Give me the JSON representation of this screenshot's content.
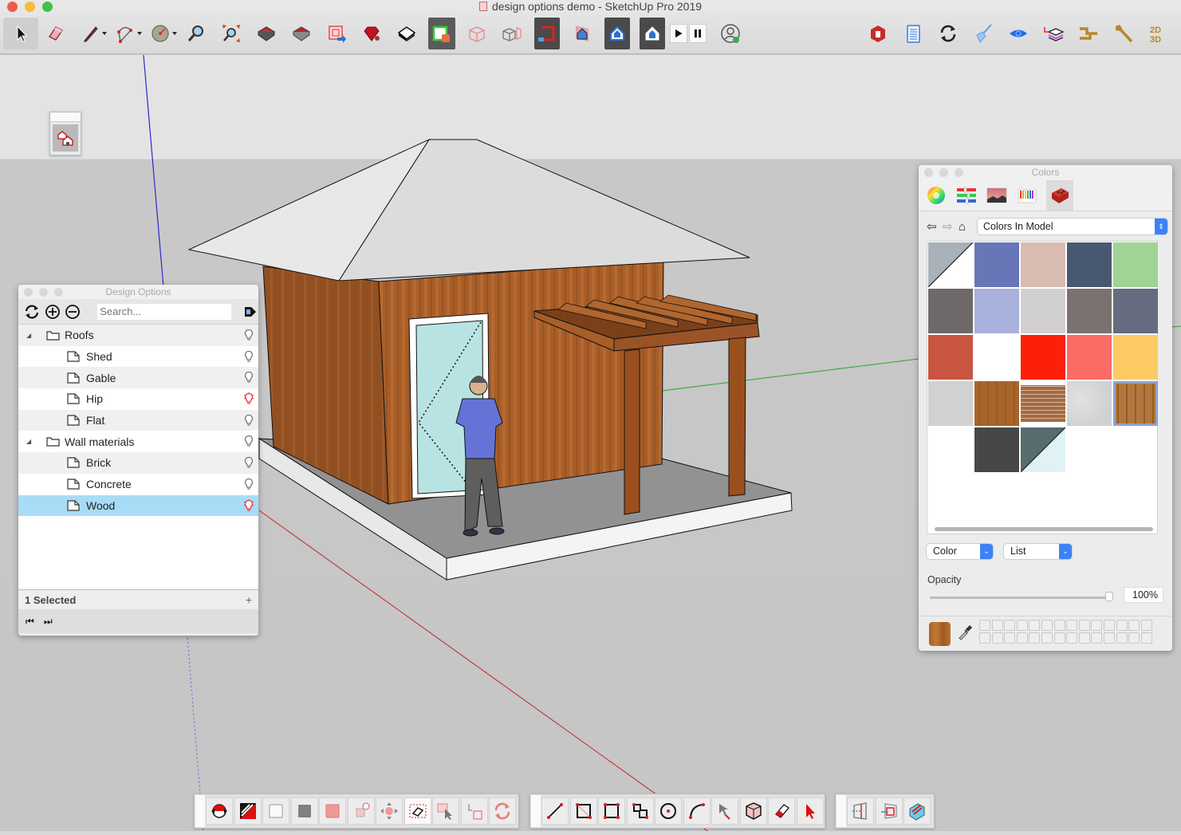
{
  "window": {
    "title": "design options demo - SketchUp Pro 2019"
  },
  "main_toolbar": {
    "left_tools": [
      {
        "name": "select-tool",
        "label": "Select",
        "active": true
      },
      {
        "name": "eraser-tool",
        "label": "Eraser"
      },
      {
        "name": "line-tool",
        "label": "Line",
        "dropdown": true
      },
      {
        "name": "arc-tool",
        "label": "Arc",
        "dropdown": true
      },
      {
        "name": "protractor-tool",
        "label": "Protractor",
        "dropdown": true
      },
      {
        "name": "zoom-tool",
        "label": "Zoom"
      },
      {
        "name": "zoom-extents-tool",
        "label": "Zoom Extents"
      },
      {
        "name": "warehouse-tool",
        "label": "3D Warehouse"
      },
      {
        "name": "share-model-tool",
        "label": "Share Model"
      },
      {
        "name": "send-to-layout-tool",
        "label": "Send to LayOut"
      },
      {
        "name": "extension-warehouse-tool",
        "label": "Extension Warehouse"
      },
      {
        "name": "paint-bucket-tool",
        "label": "Paint Bucket"
      },
      {
        "name": "component-tool",
        "label": "Make Component",
        "active": true
      },
      {
        "name": "section-cube-tool",
        "label": "Section"
      },
      {
        "name": "solid-tools",
        "label": "Solid Tools"
      },
      {
        "name": "magnet-tool",
        "label": "Magnet"
      },
      {
        "name": "house-view-tool",
        "label": "House View"
      },
      {
        "name": "house-view-tool-2",
        "label": "House View 2"
      },
      {
        "name": "house-view-tool-3",
        "label": "House View 3"
      },
      {
        "name": "play-button",
        "label": "Play"
      },
      {
        "name": "pause-button",
        "label": "Pause"
      },
      {
        "name": "account-button",
        "label": "Account"
      }
    ],
    "right_tools": [
      {
        "name": "extension-manager-tool",
        "label": "Extension Manager"
      },
      {
        "name": "notes-tool",
        "label": "Notes"
      },
      {
        "name": "refresh-tool",
        "label": "Refresh"
      },
      {
        "name": "cleanup-tool",
        "label": "Cleanup"
      },
      {
        "name": "visibility-tool",
        "label": "Visibility"
      },
      {
        "name": "layers-tool",
        "label": "Layers"
      },
      {
        "name": "pipes-tool",
        "label": "Pipes"
      },
      {
        "name": "wrench-tool",
        "label": "Wrench"
      },
      {
        "name": "2d3d-tool",
        "label": "2D/3D"
      }
    ]
  },
  "design_options": {
    "title": "Design Options",
    "search_placeholder": "Search...",
    "tree": [
      {
        "label": "Roofs",
        "type": "folder",
        "expanded": true,
        "active": false
      },
      {
        "label": "Shed",
        "type": "option",
        "active": false
      },
      {
        "label": "Gable",
        "type": "option",
        "active": false
      },
      {
        "label": "Hip",
        "type": "option",
        "active": true
      },
      {
        "label": "Flat",
        "type": "option",
        "active": false
      },
      {
        "label": "Wall materials",
        "type": "folder",
        "expanded": true,
        "active": false
      },
      {
        "label": "Brick",
        "type": "option",
        "active": false
      },
      {
        "label": "Concrete",
        "type": "option",
        "active": false
      },
      {
        "label": "Wood",
        "type": "option",
        "active": true,
        "selected": true
      }
    ],
    "status": "1 Selected",
    "status_plus": "+",
    "nav_prev": "⏮",
    "nav_next": "⏭"
  },
  "colors": {
    "title": "Colors",
    "tabs": [
      "color-wheel",
      "color-sliders",
      "color-image",
      "color-pencils",
      "materials"
    ],
    "active_tab": "materials",
    "collection": "Colors In Model",
    "swatches": [
      {
        "type": "split",
        "a": "#a9b1b8",
        "b": "#ffffff"
      },
      {
        "type": "solid",
        "color": "#6776b6"
      },
      {
        "type": "solid",
        "color": "#d8bcb0"
      },
      {
        "type": "solid",
        "color": "#495871"
      },
      {
        "type": "solid",
        "color": "#a0d495"
      },
      {
        "type": "solid",
        "color": "#6e6869"
      },
      {
        "type": "solid",
        "color": "#a8b0dc"
      },
      {
        "type": "solid",
        "color": "#d1cfd0"
      },
      {
        "type": "solid",
        "color": "#7b716f"
      },
      {
        "type": "solid",
        "color": "#676b7f"
      },
      {
        "type": "solid",
        "color": "#c85641"
      },
      {
        "type": "solid",
        "color": "#ffffff"
      },
      {
        "type": "solid",
        "color": "#fb2007"
      },
      {
        "type": "solid",
        "color": "#fb6c67"
      },
      {
        "type": "solid",
        "color": "#fdca63"
      },
      {
        "type": "solid",
        "color": "#d1d1d1"
      },
      {
        "type": "texture",
        "name": "wood-1",
        "color": "#a9642a"
      },
      {
        "type": "texture",
        "name": "brick",
        "color": "#a36a43"
      },
      {
        "type": "texture",
        "name": "concrete",
        "color": "#d0d1d2"
      },
      {
        "type": "texture",
        "name": "wood-2",
        "color": "#b1773e",
        "selected": true
      },
      {
        "type": "solid",
        "color": "#ffffff"
      },
      {
        "type": "solid",
        "color": "#474747"
      },
      {
        "type": "split",
        "a": "#566c6f",
        "b": "#e1f2f6"
      }
    ],
    "mode_select": "Color",
    "view_select": "List",
    "opacity_label": "Opacity",
    "opacity_percent": 100,
    "opacity_text": "100%"
  }
}
